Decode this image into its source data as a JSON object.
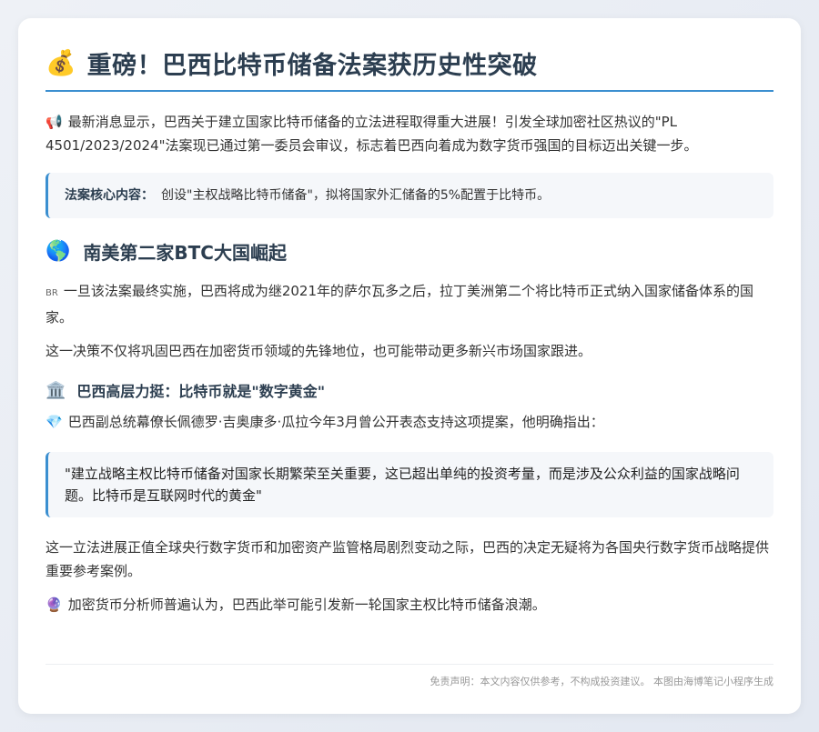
{
  "title": {
    "icon": "💰",
    "text": "重磅！巴西比特币储备法案获历史性突破"
  },
  "intro": {
    "icon": "📢",
    "text": "最新消息显示，巴西关于建立国家比特币储备的立法进程取得重大进展！引发全球加密社区热议的\"PL 4501/2023/2024\"法案现已通过第一委员会审议，标志着巴西向着成为数字货币强国的目标迈出关键一步。"
  },
  "callout": {
    "label": "法案核心内容：",
    "text": "创设\"主权战略比特币储备\"，拟将国家外汇储备的5%配置于比特币。"
  },
  "section1": {
    "icon": "🌎",
    "heading": "南美第二家BTC大国崛起",
    "flag": "BR",
    "p1": "一旦该法案最终实施，巴西将成为继2021年的萨尔瓦多之后，拉丁美洲第二个将比特币正式纳入国家储备体系的国家。",
    "p2": "这一决策不仅将巩固巴西在加密货币领域的先锋地位，也可能带动更多新兴市场国家跟进。"
  },
  "section2": {
    "icon": "🏛️",
    "heading": "巴西高层力挺：比特币就是\"数字黄金\"",
    "line_icon": "💎",
    "line": "巴西副总统幕僚长佩德罗·吉奥康多·瓜拉今年3月曾公开表态支持这项提案，他明确指出：",
    "quote": "\"建立战略主权比特币储备对国家长期繁荣至关重要，这已超出单纯的投资考量，而是涉及公众利益的国家战略问题。比特币是互联网时代的黄金\""
  },
  "closing": {
    "p1": "这一立法进展正值全球央行数字货币和加密资产监管格局剧烈变动之际，巴西的决定无疑将为各国央行数字货币战略提供重要参考案例。",
    "icon": "🔮",
    "p2": "加密货币分析师普遍认为，巴西此举可能引发新一轮国家主权比特币储备浪潮。"
  },
  "footer": {
    "text": "免责声明：本文内容仅供参考，不构成投资建议。 本图由海博笔记小程序生成"
  },
  "colors": {
    "accent": "#3b8fd0",
    "heading": "#2c3e50",
    "callout_bg": "#f5f7fa"
  }
}
